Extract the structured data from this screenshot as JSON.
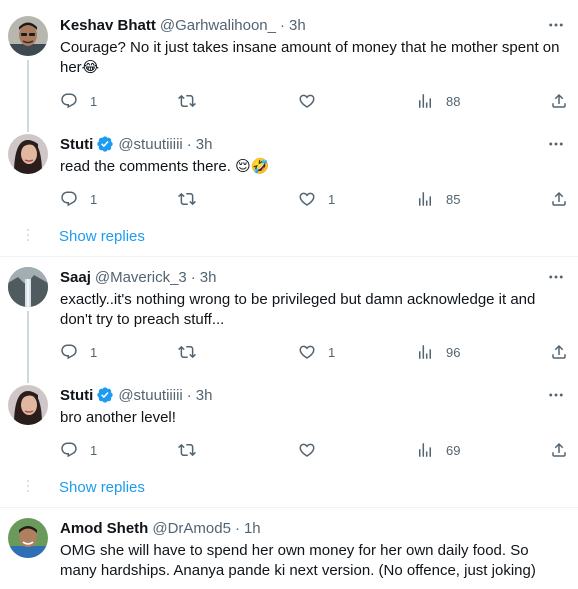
{
  "tweets": [
    {
      "name": "Keshav Bhatt",
      "handle": "@Garhwalihoon_",
      "time": "3h",
      "text": "Courage? No it just takes insane amount of money that he mother spent on her😂",
      "replies": "1",
      "retweets": "",
      "likes": "",
      "views": "88",
      "verified": false
    },
    {
      "name": "Stuti",
      "handle": "@stuutiiiii",
      "time": "3h",
      "text": "read the comments there. 😌🤣",
      "replies": "1",
      "retweets": "",
      "likes": "1",
      "views": "85",
      "verified": true
    },
    {
      "name": "Saaj",
      "handle": "@Maverick_3",
      "time": "3h",
      "text": "exactly..it's nothing wrong to be privileged but damn acknowledge it and don't try to preach stuff...",
      "replies": "1",
      "retweets": "",
      "likes": "1",
      "views": "96",
      "verified": false
    },
    {
      "name": "Stuti",
      "handle": "@stuutiiiii",
      "time": "3h",
      "text": "bro another level!",
      "replies": "1",
      "retweets": "",
      "likes": "",
      "views": "69",
      "verified": true
    },
    {
      "name": "Amod Sheth",
      "handle": "@DrAmod5",
      "time": "1h",
      "text": "OMG she will have to spend her own money for her own daily food. So many hardships. Ananya pande ki next version. (No offence, just joking)",
      "verified": false
    }
  ],
  "show_replies_label": "Show replies",
  "separator": "·",
  "colors": {
    "accent": "#1d9bf0",
    "muted": "#536471",
    "divider": "#eff3f4"
  }
}
